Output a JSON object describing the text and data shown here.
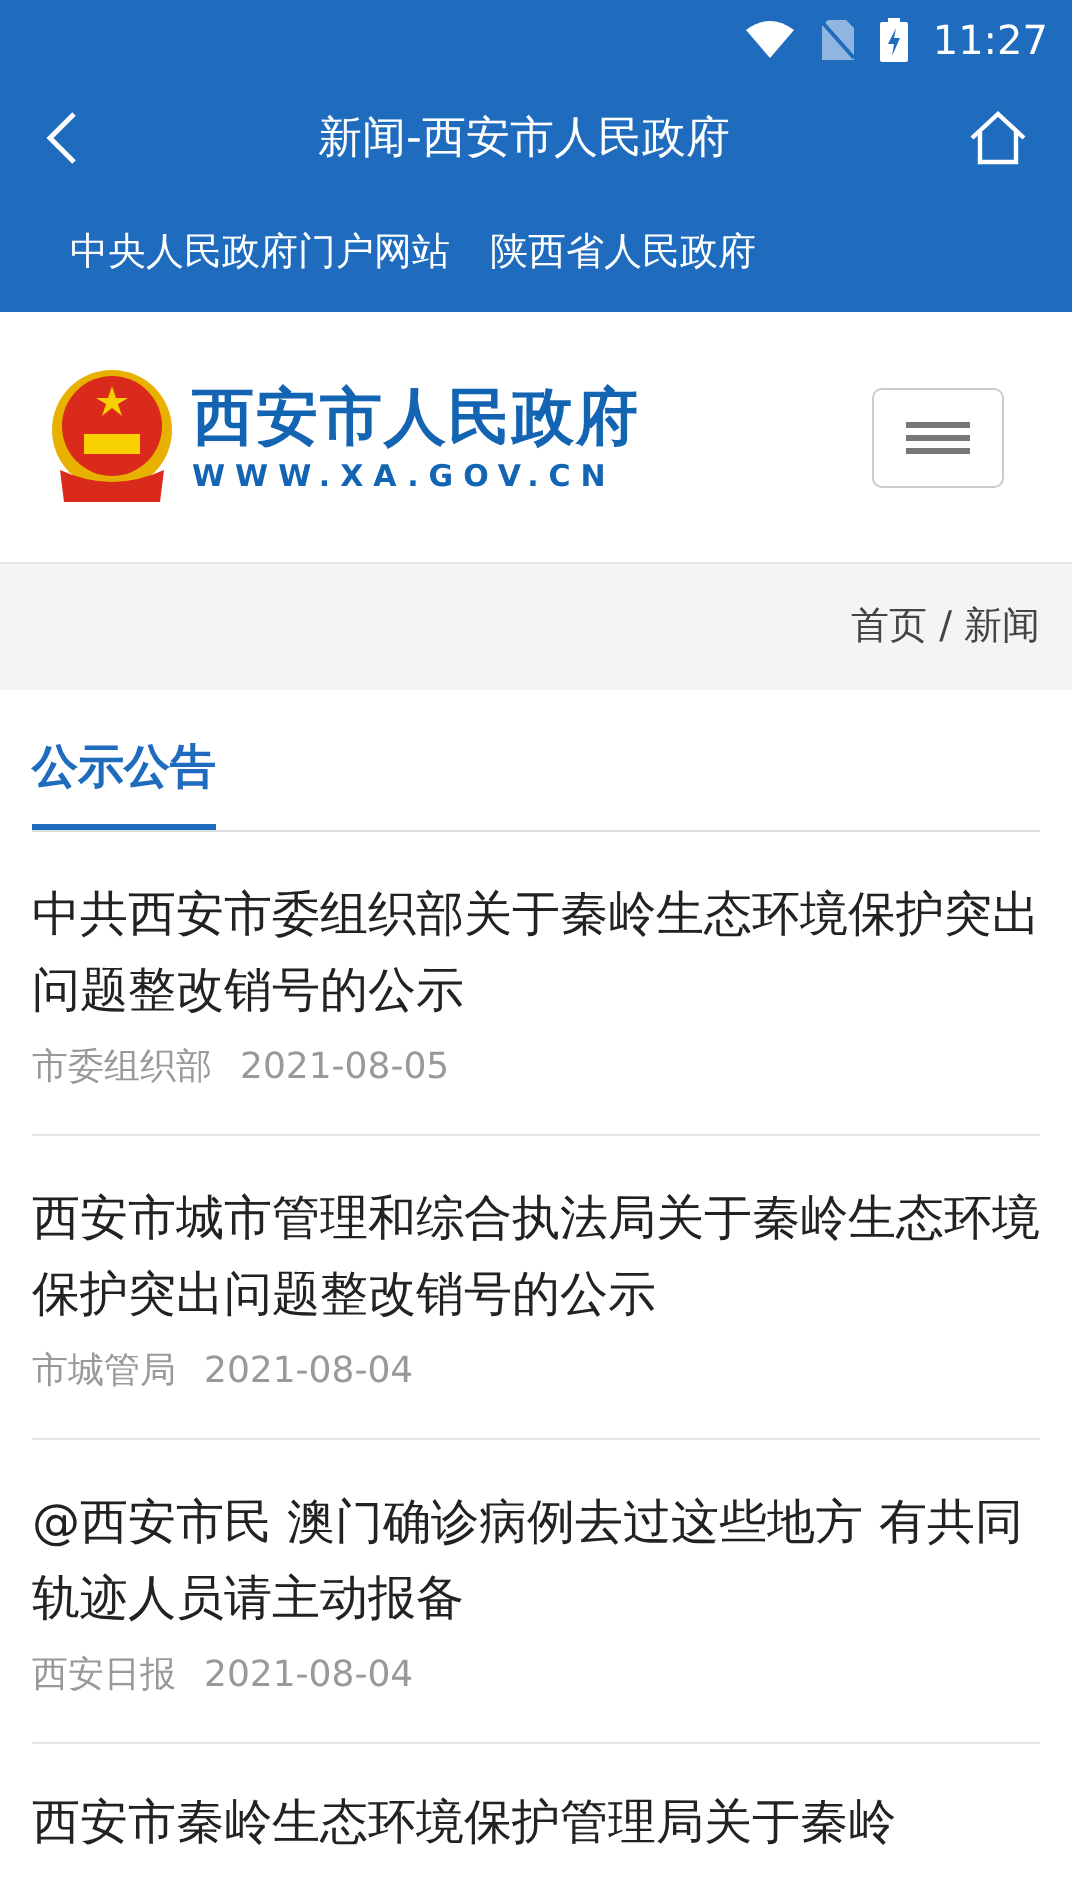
{
  "status_bar": {
    "time": "11:27"
  },
  "title_bar": {
    "title": "新闻-西安市人民政府"
  },
  "top_links": [
    "中央人民政府门户网站",
    "陕西省人民政府"
  ],
  "logo": {
    "name": "西安市人民政府",
    "url": "WWW.XA.GOV.CN"
  },
  "breadcrumb": [
    {
      "label": "首页"
    },
    {
      "label": "/"
    },
    {
      "label": "新闻"
    }
  ],
  "tabs": [
    {
      "label": "公示公告",
      "selected": true
    }
  ],
  "articles": [
    {
      "title": "中共西安市委组织部关于秦岭生态环境保护突出问题整改销号的公示",
      "source": "市委组织部",
      "date": "2021-08-05"
    },
    {
      "title": "西安市城市管理和综合执法局关于秦岭生态环境保护突出问题整改销号的公示",
      "source": "市城管局",
      "date": "2021-08-04"
    },
    {
      "title": "@西安市民 澳门确诊病例去过这些地方 有共同轨迹人员请主动报备",
      "source": "西安日报",
      "date": "2021-08-04"
    },
    {
      "title": "西安市秦岭生态环境保护管理局关于秦岭"
    }
  ]
}
